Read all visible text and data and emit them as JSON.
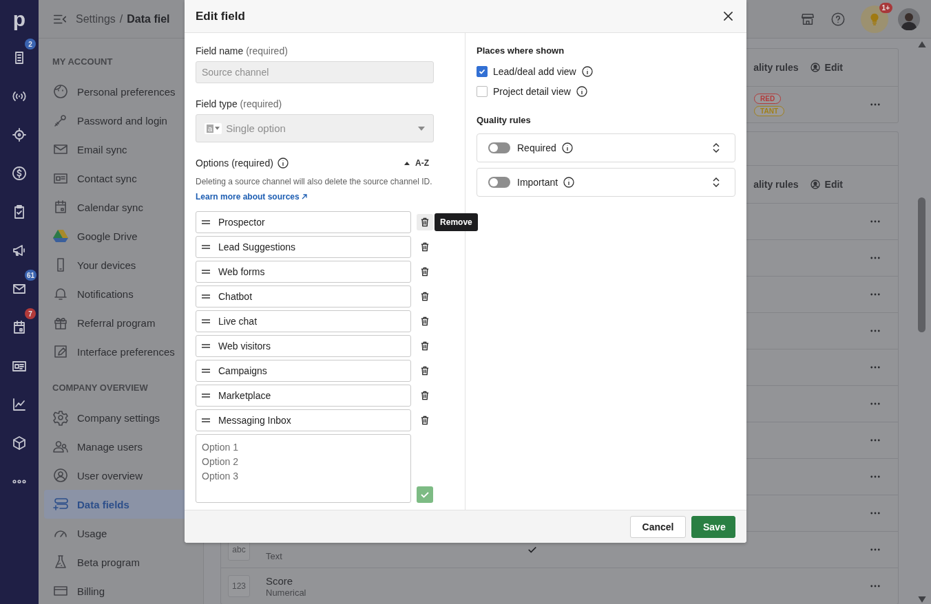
{
  "rail": {
    "logo": "p",
    "badges": [
      {
        "text": "2",
        "color": "#3a63b0"
      },
      {
        "text": "61",
        "color": "#3a63b0"
      },
      {
        "text": "7",
        "color": "#b23a3a"
      }
    ]
  },
  "header": {
    "crumbs": [
      "Settings",
      "/",
      "Data fiel"
    ],
    "bulb_badge": "1+"
  },
  "sidebar": {
    "sections": [
      {
        "title": "MY ACCOUNT",
        "items": [
          {
            "label": "Personal preferences",
            "selected": false
          },
          {
            "label": "Password and login",
            "selected": false
          },
          {
            "label": "Email sync",
            "selected": false
          },
          {
            "label": "Contact sync",
            "selected": false
          },
          {
            "label": "Calendar sync",
            "selected": false
          },
          {
            "label": "Google Drive",
            "selected": false
          },
          {
            "label": "Your devices",
            "selected": false
          },
          {
            "label": "Notifications",
            "selected": false
          },
          {
            "label": "Referral program",
            "selected": false
          },
          {
            "label": "Interface preferences",
            "selected": false
          }
        ]
      },
      {
        "title": "COMPANY OVERVIEW",
        "items": [
          {
            "label": "Company settings",
            "selected": false
          },
          {
            "label": "Manage users",
            "selected": false
          },
          {
            "label": "User overview",
            "selected": false
          },
          {
            "label": "Data fields",
            "selected": true
          },
          {
            "label": "Usage",
            "selected": false
          },
          {
            "label": "Beta program",
            "selected": false
          },
          {
            "label": "Billing",
            "selected": false
          }
        ]
      }
    ]
  },
  "cards": [
    {
      "header": {
        "column_1": "ality rules",
        "column_2": "Edit"
      },
      "tags": [
        {
          "text": "RED",
          "color": "#b23a3a"
        },
        {
          "text": "TANT",
          "color": "#a0801a"
        }
      ]
    },
    {
      "header": {
        "column_1": "ality rules",
        "column_2": "Edit"
      },
      "rows": [
        {},
        {},
        {},
        {},
        {},
        {},
        {},
        {},
        {},
        {
          "type_icon": "abc",
          "subtitle": "Text",
          "checked": true
        },
        {
          "type_icon": "123",
          "name": "Score",
          "subtitle": "Numerical"
        }
      ]
    }
  ],
  "modal": {
    "title": "Edit field",
    "field_name": {
      "label": "Field name",
      "hint": "(required)",
      "value": "Source channel",
      "disabled": true
    },
    "field_type": {
      "label": "Field type",
      "hint": "(required)",
      "type_icon": "a",
      "value": "Single option",
      "disabled": true
    },
    "options": {
      "label": "Options (required)",
      "sort": "A-Z",
      "note": "Deleting a source channel will also delete the source channel ID.",
      "link": "Learn more about sources",
      "tooltip": "Remove",
      "items": [
        {
          "label": "Prospector",
          "hovered": true
        },
        {
          "label": "Lead Suggestions",
          "hovered": false
        },
        {
          "label": "Web forms",
          "hovered": false
        },
        {
          "label": "Chatbot",
          "hovered": false
        },
        {
          "label": "Live chat",
          "hovered": false
        },
        {
          "label": "Web visitors",
          "hovered": false
        },
        {
          "label": "Campaigns",
          "hovered": false
        },
        {
          "label": "Marketplace",
          "hovered": false
        },
        {
          "label": "Messaging Inbox",
          "hovered": false
        }
      ],
      "new_placeholder": "Option 1\nOption 2\nOption 3"
    },
    "places": {
      "title": "Places where shown",
      "items": [
        {
          "label": "Lead/deal add view",
          "checked": true
        },
        {
          "label": "Project detail view",
          "checked": false
        }
      ]
    },
    "quality": {
      "title": "Quality rules",
      "rules": [
        {
          "label": "Required",
          "on": false
        },
        {
          "label": "Important",
          "on": false
        }
      ]
    },
    "buttons": [
      {
        "label": "Cancel",
        "kind": "secondary"
      },
      {
        "label": "Save",
        "kind": "primary"
      }
    ]
  }
}
